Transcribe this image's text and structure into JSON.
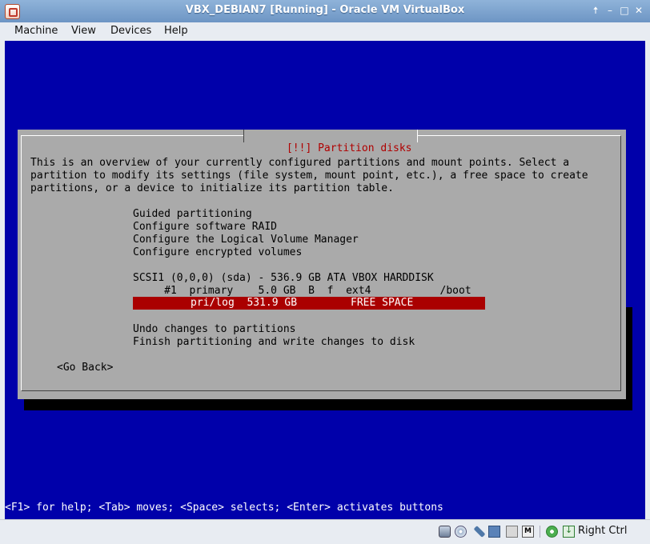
{
  "window": {
    "title": "VBX_DEBIAN7 [Running] - Oracle VM VirtualBox",
    "buttons": {
      "shade": "🠅",
      "minimize": "–",
      "maximize": "□",
      "close": "✕"
    }
  },
  "menubar": {
    "items": [
      "Machine",
      "View",
      "Devices",
      "Help"
    ]
  },
  "installer": {
    "dialog_title": "[!!] Partition disks",
    "intro_lines": [
      "This is an overview of your currently configured partitions and mount points. Select a",
      "partition to modify its settings (file system, mount point, etc.), a free space to create",
      "partitions, or a device to initialize its partition table."
    ],
    "options": [
      "Guided partitioning",
      "Configure software RAID",
      "Configure the Logical Volume Manager",
      "Configure encrypted volumes"
    ],
    "disk": "SCSI1 (0,0,0) (sda) - 536.9 GB ATA VBOX HARDDISK",
    "partition_row": "     #1  primary    5.0 GB  B  f  ext4           /boot",
    "free_row": {
      "text": "pri/log  531.9 GB",
      "label": "FREE SPACE"
    },
    "actions": [
      "Undo changes to partitions",
      "Finish partitioning and write changes to disk"
    ],
    "go_back": "<Go Back>",
    "help_line": "<F1> for help; <Tab> moves; <Space> selects; <Enter> activates buttons"
  },
  "statusbar": {
    "video_icon_label": "M",
    "host_key": "Right Ctrl"
  },
  "colors": {
    "guest_background": "#0000aa",
    "dialog_background": "#aaaaaa",
    "highlight": "#aa0000",
    "dialog_title": "#b00000"
  }
}
